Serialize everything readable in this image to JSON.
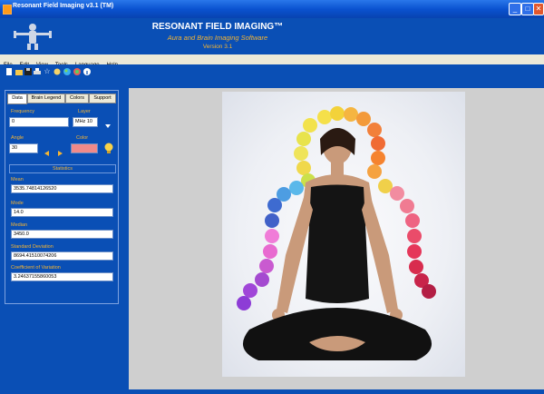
{
  "window": {
    "title": "Resonant Field Imaging v3.1 (TM)",
    "buttons": {
      "minimize": "_",
      "maximize": "□",
      "close": "✕"
    }
  },
  "banner": {
    "title": "RESONANT FIELD IMAGING™",
    "subtitle": "Aura and Brain Imaging Software",
    "version": "Version 3.1"
  },
  "menu": [
    "File",
    "Edit",
    "View",
    "Tools",
    "Language",
    "Help"
  ],
  "toolbar_icons": [
    "new-file-icon",
    "open-folder-icon",
    "save-icon",
    "print-icon",
    "star-icon",
    "settings-icon",
    "globe-icon",
    "palette-icon",
    "info-icon"
  ],
  "tabs": [
    "Data",
    "Brain Legend",
    "Colors",
    "Support"
  ],
  "controls": {
    "frequency_label": "Frequency",
    "frequency_value": "0",
    "layer_label": "Layer",
    "layer_value": "MHz 10",
    "angle_label": "Angle",
    "angle_value": "30",
    "color_label": "Color",
    "color_value": "#f08a8a"
  },
  "statistics": {
    "header": "Statistics",
    "fields": [
      {
        "label": "Mean",
        "value": "3535.74814126520"
      },
      {
        "label": "Mode",
        "value": "14.0"
      },
      {
        "label": "Median",
        "value": "3450.0"
      },
      {
        "label": "Standard Deviation",
        "value": "8694.41510074206"
      },
      {
        "label": "Coefficient of Variation",
        "value": "3.24637155860053"
      }
    ]
  },
  "colors": {
    "accent": "#f7b531",
    "background": "#0a4fb5",
    "menubar": "#ece9d8"
  }
}
